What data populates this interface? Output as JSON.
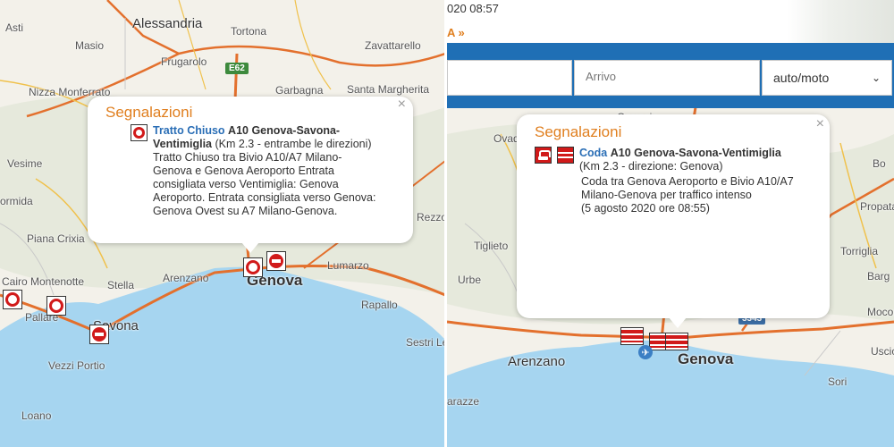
{
  "left": {
    "places": {
      "asti": "Asti",
      "alessandria": "Alessandria",
      "tortona": "Tortona",
      "masio": "Masio",
      "frugarolo": "Frugarolo",
      "zavattarello": "Zavattarello",
      "nizza": "Nizza Monferrato",
      "garbagna": "Garbagna",
      "santa_margherita": "Santa Margherita",
      "vesime": "Vesime",
      "ormida": "ormida",
      "piana_crixia": "Piana Crixia",
      "cairo": "Cairo Montenotte",
      "pallare": "Pallare",
      "savona": "Savona",
      "stella": "Stella",
      "arenzano": "Arenzano",
      "genova": "Genova",
      "lumarzo": "Lumarzo",
      "rapallo": "Rapallo",
      "sestri": "Sestri Le",
      "vezzi": "Vezzi Portio",
      "loano": "Loano",
      "rezzoa": "Rezzoa"
    },
    "road_badge": "E62",
    "popup": {
      "title": "Segnalazioni",
      "close": "×",
      "type_link": "Tratto Chiuso",
      "road": "A10 Genova-Savona-Ventimiglia",
      "km": "(Km 2.3 - entrambe le direzioni)",
      "description": "Tratto Chiuso tra Bivio A10/A7 Milano-Genova e Genova Aeroporto Entrata consigliata verso Ventimiglia: Genova Aeroporto. Entrata consigliata verso Genova: Genova Ovest su A7 Milano-Genova."
    }
  },
  "right": {
    "date_partial": "020 08:57",
    "link_partial": "A »",
    "arrivo_placeholder": "Arrivo",
    "vehicle_select": "auto/moto",
    "places": {
      "ovad": "Ovad",
      "garrocio": "Garrocio",
      "tiglieto": "Tiglieto",
      "urbe": "Urbe",
      "arenzano": "Arenzano",
      "genova": "Genova",
      "varazze": "arazze",
      "sori": "Sori",
      "propata": "Propata",
      "torriglia": "Torriglia",
      "moconesi": "Mocor",
      "bargagli": "Barg",
      "uscio": "Uscio",
      "bo": "Bo"
    },
    "road_badge": "3343",
    "popup": {
      "title": "Segnalazioni",
      "close": "×",
      "type_link": "Coda",
      "road": "A10 Genova-Savona-Ventimiglia",
      "km": "(Km 2.3 - direzione: Genova)",
      "description": "Coda tra Genova Aeroporto e Bivio A10/A7 Milano-Genova per traffico intenso",
      "timestamp": "(5 agosto 2020 ore 08:55)"
    }
  },
  "colors": {
    "sea": "#a6d5f0",
    "land": "#f3f1ea",
    "accent_orange": "#e07f1f",
    "link_blue": "#2a6eb6",
    "header_blue": "#1f6fb5",
    "alert_red": "#d11a1a"
  }
}
